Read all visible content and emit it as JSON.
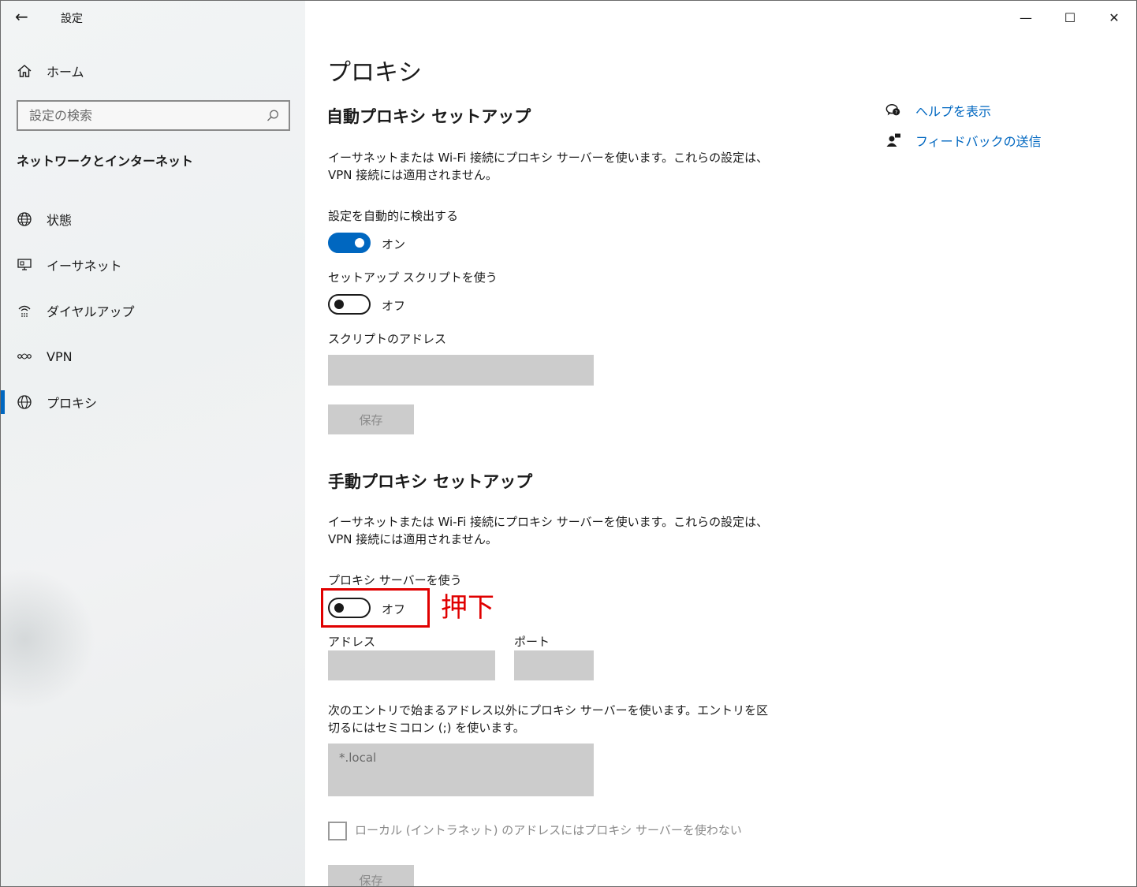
{
  "window": {
    "title": "設定",
    "controls": {
      "minimize": "—",
      "maximize": "☐",
      "close": "✕"
    }
  },
  "sidebar": {
    "back": "←",
    "home_label": "ホーム",
    "search_placeholder": "設定の検索",
    "section_title": "ネットワークとインターネット",
    "items": [
      {
        "label": "状態",
        "icon": "globe-status-icon"
      },
      {
        "label": "イーサネット",
        "icon": "ethernet-monitor-icon"
      },
      {
        "label": "ダイヤルアップ",
        "icon": "dialup-icon"
      },
      {
        "label": "VPN",
        "icon": "vpn-icon"
      },
      {
        "label": "プロキシ",
        "icon": "globe-icon",
        "active": true
      }
    ]
  },
  "main": {
    "page_title": "プロキシ",
    "auto": {
      "heading": "自動プロキシ セットアップ",
      "description": "イーサネットまたは Wi-Fi 接続にプロキシ サーバーを使います。これらの設定は、VPN 接続には適用されません。",
      "detect_label": "設定を自動的に検出する",
      "detect_state": "オン",
      "script_label": "セットアップ スクリプトを使う",
      "script_state": "オフ",
      "address_label": "スクリプトのアドレス",
      "save_label": "保存"
    },
    "manual": {
      "heading": "手動プロキシ セットアップ",
      "description": "イーサネットまたは Wi-Fi 接続にプロキシ サーバーを使います。これらの設定は、VPN 接続には適用されません。",
      "use_proxy_label": "プロキシ サーバーを使う",
      "use_proxy_state": "オフ",
      "address_label": "アドレス",
      "port_label": "ポート",
      "exceptions_text": "次のエントリで始まるアドレス以外にプロキシ サーバーを使います。エントリを区切るにはセミコロン (;) を使います。",
      "exceptions_value": "*.local",
      "local_bypass_label": "ローカル (イントラネット) のアドレスにはプロキシ サーバーを使わない",
      "save_label": "保存"
    }
  },
  "help": {
    "show_help": "ヘルプを表示",
    "send_feedback": "フィードバックの送信"
  },
  "annotation": {
    "text": "押下",
    "color": "#e00000"
  },
  "colors": {
    "accent": "#0067c0",
    "disabled_fill": "#cccccc"
  }
}
